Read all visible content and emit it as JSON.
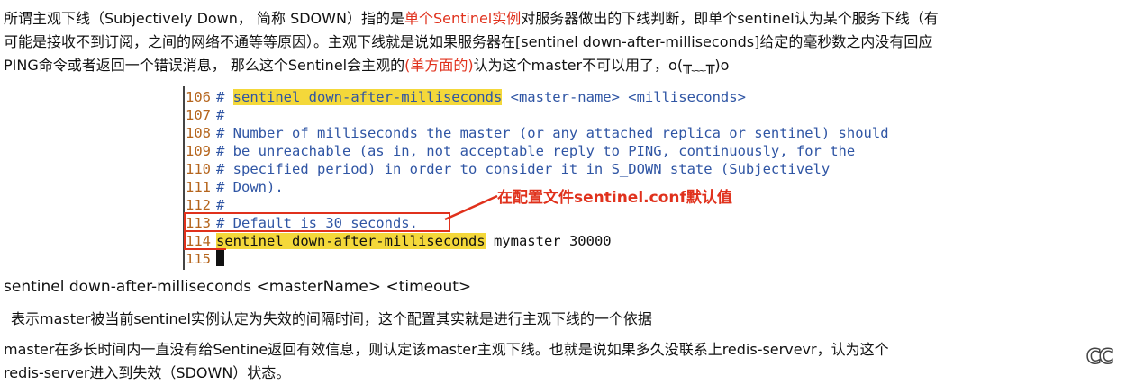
{
  "intro": {
    "line1_a": "所谓主观下线（Subjectively Down， 简称 SDOWN）指的是",
    "line1_red": "单个Sentinel实例",
    "line1_b": "对服务器做出的下线判断，即单个sentinel认为某个服务下线（有",
    "line2": "可能是接收不到订阅，之间的网络不通等等原因）。主观下线就是说如果服务器在[sentinel down-after-milliseconds]给定的毫秒数之内没有回应",
    "line3_a": "PING命令或者返回一个错误消息， 那么这个Sentinel会主观的",
    "line3_red": "(单方面的)",
    "line3_b": "认为这个master不可以用了，o(╥﹏╥)o"
  },
  "code": {
    "l106_num": "106",
    "l106_hash": "# ",
    "l106_hl": "sentinel down-after-milliseconds",
    "l106_rest": " <master-name> <milliseconds>",
    "l107_num": "107",
    "l107_text": "#",
    "l108_num": "108",
    "l108_text": "# Number of milliseconds the master (or any attached replica or sentinel) should",
    "l109_num": "109",
    "l109_text": "# be unreachable (as in, not acceptable reply to PING, continuously, for the",
    "l110_num": "110",
    "l110_text": "# specified period) in order to consider it in S_DOWN state (Subjectively",
    "l111_num": "111",
    "l111_text": "# Down).",
    "l112_num": "112",
    "l112_text": "#",
    "l113_num": "113",
    "l113_text": "# Default is 30 seconds.",
    "l114_num": "114",
    "l114_hl": "sentinel down-after-milliseconds",
    "l114_rest": " mymaster 30000",
    "l115_num": "115"
  },
  "annotation": "在配置文件sentinel.conf默认值",
  "syntax": "sentinel down-after-milliseconds <masterName> <timeout>",
  "desc": "表示master被当前sentinel实例认定为失效的间隔时间，这个配置其实就是进行主观下线的一个依据",
  "detail": {
    "line1": "master在多长时间内一直没有给Sentine返回有效信息，则认定该master主观下线。也就是说如果多久没联系上redis-servevr，认为这个",
    "line2": "redis-server进入到失效（SDOWN）状态。"
  },
  "watermark": "CC"
}
